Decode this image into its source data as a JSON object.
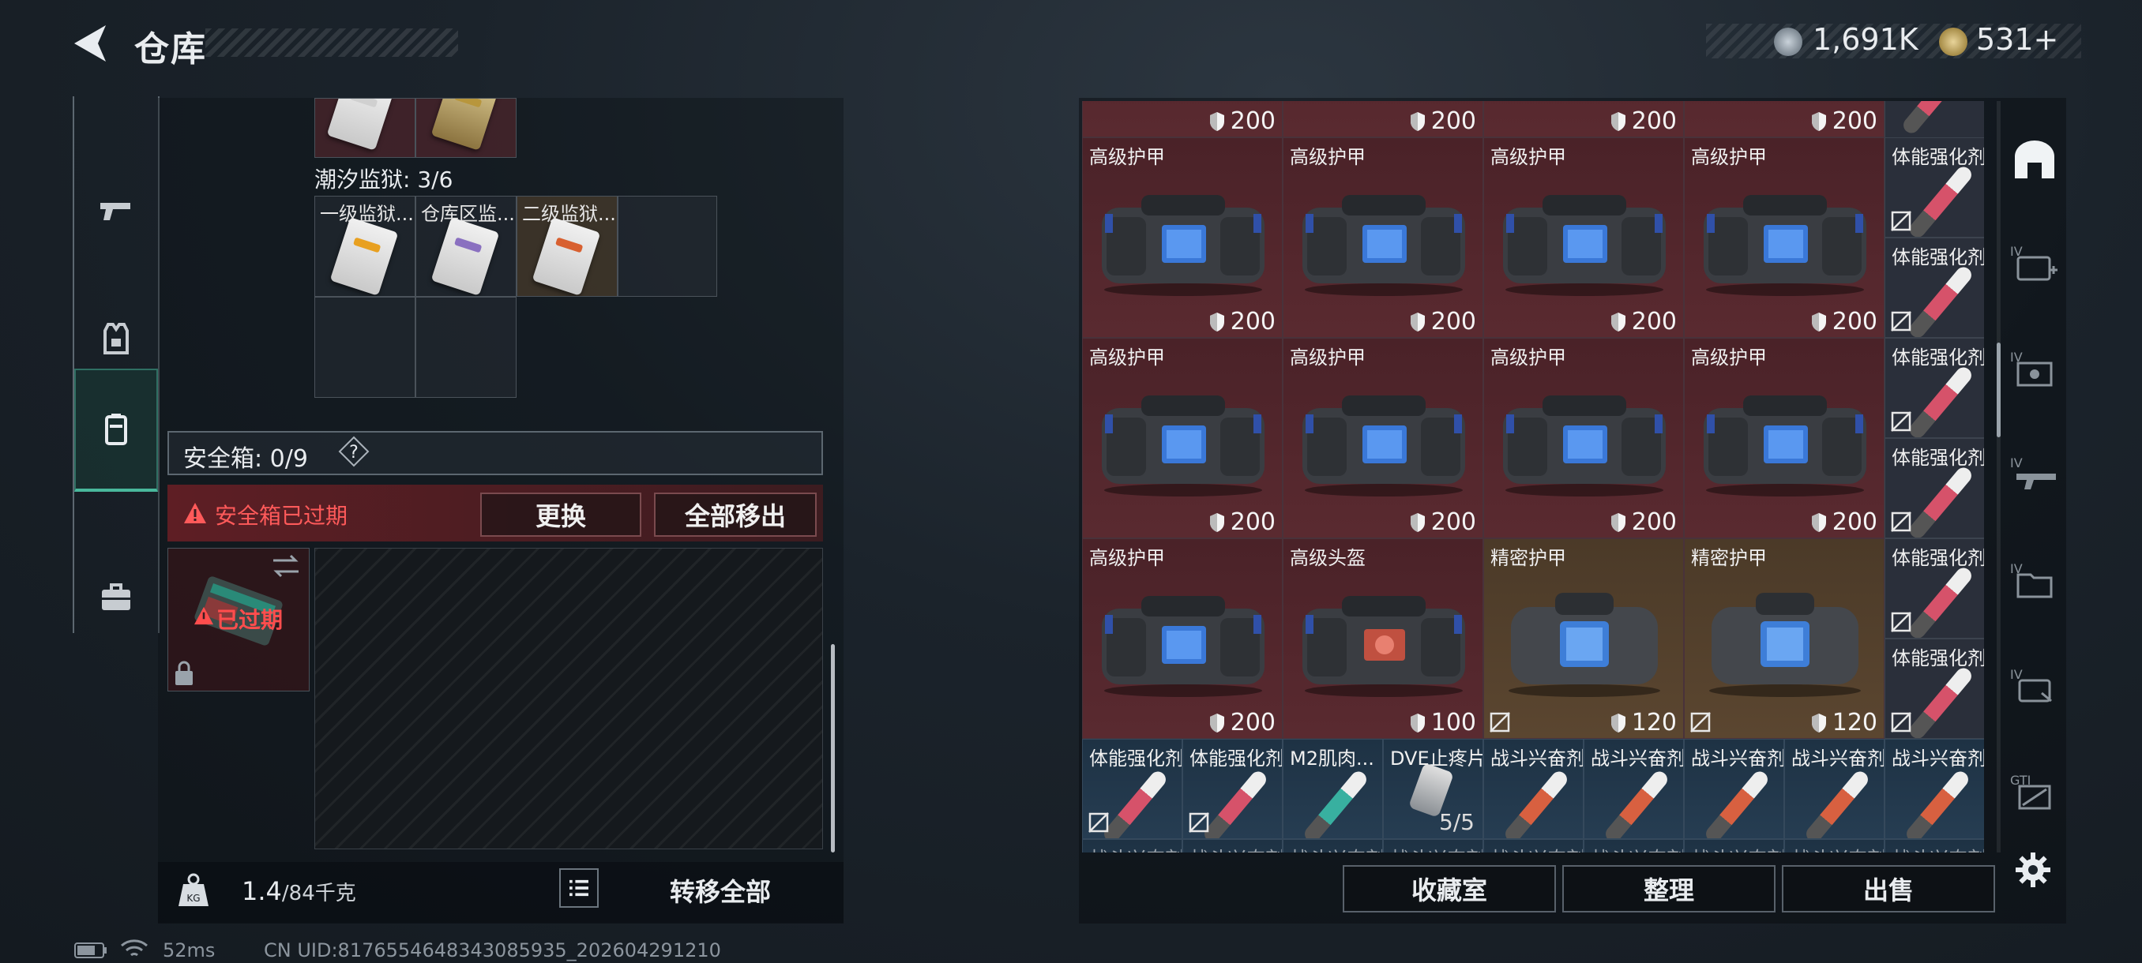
{
  "header": {
    "title": "仓库",
    "currency1": "1,691K",
    "currency2": "531+"
  },
  "side_tabs": [
    "gun-tab",
    "armor-tab",
    "case-tab",
    "briefcase-tab"
  ],
  "left_panel": {
    "prison_label": "潮汐监狱: 3/6",
    "prison_items": [
      "一级监狱...",
      "仓库区监...",
      "二级监狱..."
    ],
    "safebox_label": "安全箱: 0/9",
    "safebox_help": "?",
    "expired_text": "安全箱已过期",
    "replace_label": "更换",
    "remove_all_label": "全部移出",
    "case_expired": "已过期",
    "weight_value": "1.4",
    "weight_max": "/84千克",
    "transfer_all_label": "转移全部"
  },
  "stash": {
    "top_durabilities": [
      "200",
      "200",
      "200",
      "200"
    ],
    "rows": [
      [
        {
          "name": "高级护甲",
          "dur": "200",
          "theme": "red"
        },
        {
          "name": "高级护甲",
          "dur": "200",
          "theme": "red"
        },
        {
          "name": "高级护甲",
          "dur": "200",
          "theme": "red"
        },
        {
          "name": "高级护甲",
          "dur": "200",
          "theme": "red"
        }
      ],
      [
        {
          "name": "高级护甲",
          "dur": "200",
          "theme": "red"
        },
        {
          "name": "高级护甲",
          "dur": "200",
          "theme": "red"
        },
        {
          "name": "高级护甲",
          "dur": "200",
          "theme": "red"
        },
        {
          "name": "高级护甲",
          "dur": "200",
          "theme": "red"
        }
      ],
      [
        {
          "name": "高级护甲",
          "dur": "200",
          "theme": "red"
        },
        {
          "name": "高级头盔",
          "dur": "100",
          "theme": "red"
        },
        {
          "name": "精密护甲",
          "dur": "120",
          "theme": "gold"
        },
        {
          "name": "精密护甲",
          "dur": "120",
          "theme": "gold"
        }
      ]
    ],
    "side_column": [
      "体能强化剂",
      "体能强化剂",
      "体能强化剂",
      "体能强化剂",
      "体能强化剂",
      "体能强化剂"
    ],
    "bottom_row": [
      "体能强化剂",
      "体能强化剂",
      "M2肌肉...",
      "DVE止疼片",
      "战斗兴奋剂",
      "战斗兴奋剂",
      "战斗兴奋剂",
      "战斗兴奋剂",
      "战斗兴奋剂"
    ],
    "bottom_row_peek": "战斗兴奋剂",
    "dve_qty": "5/5"
  },
  "actions": {
    "collection": "收藏室",
    "organize": "整理",
    "sell": "出售"
  },
  "status": {
    "ping": "52ms",
    "uid": "CN UID:8176554648343085935_202604291210"
  },
  "colors": {
    "accent_teal": "#49b89c",
    "warning_red": "#ff5a5a",
    "rare_red": "#5a2a30",
    "rare_gold": "#5b4630",
    "common_blue": "#263d52"
  }
}
